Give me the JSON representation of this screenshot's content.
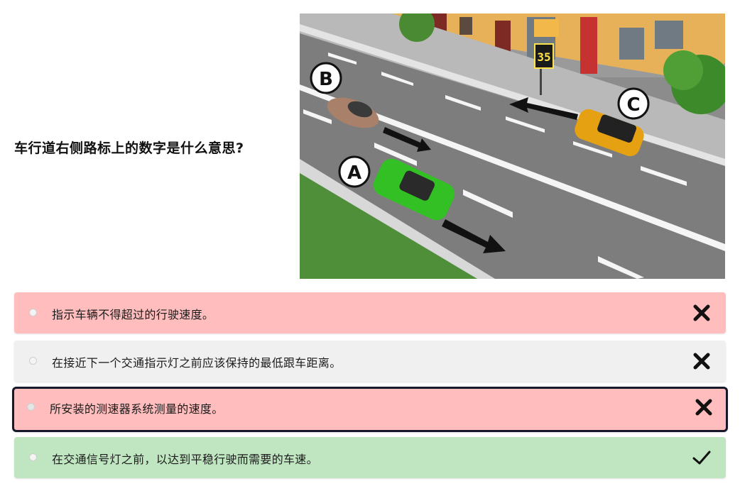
{
  "question": {
    "text": "车行道右侧路标上的数字是什么意思?"
  },
  "scene": {
    "sign_number": "35",
    "labels": [
      "A",
      "B",
      "C"
    ],
    "car_colors": {
      "A": "#33c024",
      "B": "#a9806a",
      "C": "#e6a113"
    }
  },
  "answers": [
    {
      "text": "指示车辆不得超过的行驶速度。",
      "status": "wrong",
      "mark": "cross-icon"
    },
    {
      "text": "在接近下一个交通指示灯之前应该保持的最低跟车距离。",
      "status": "neutral",
      "mark": "cross-icon"
    },
    {
      "text": "所安装的测速器系统测量的速度。",
      "status": "wrong",
      "mark": "cross-icon",
      "selected": true
    },
    {
      "text": "在交通信号灯之前，以达到平稳行驶而需要的车速。",
      "status": "correct",
      "mark": "check-icon"
    }
  ],
  "colors": {
    "wrong_bg": "#ffbdbd",
    "neutral_bg": "#f0f0f0",
    "correct_bg": "#c0e6c1",
    "selected_border": "#16192c"
  }
}
